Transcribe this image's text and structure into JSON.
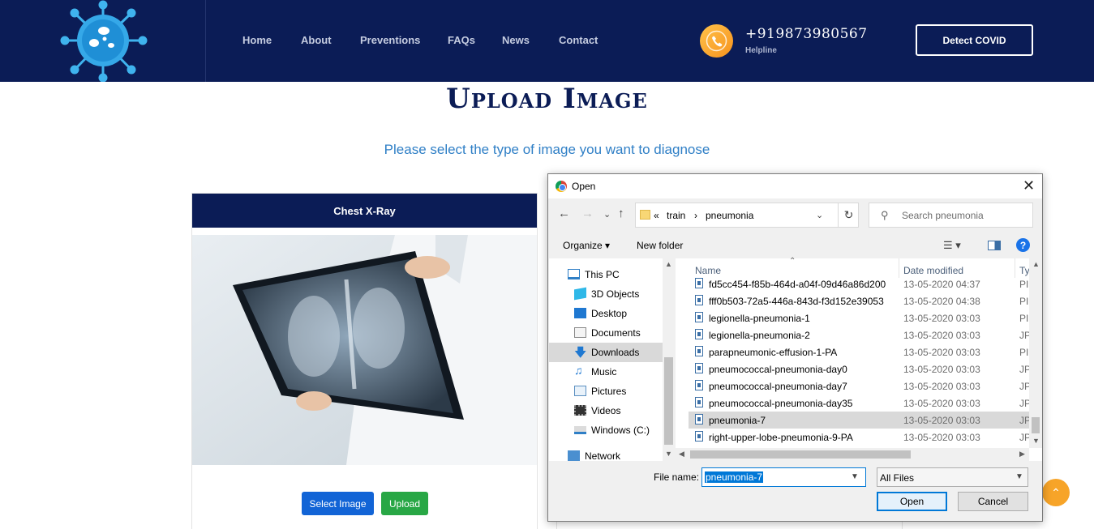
{
  "header": {
    "nav": [
      "Home",
      "About",
      "Preventions",
      "FAQs",
      "News",
      "Contact"
    ],
    "phone": "+919873980567",
    "helpline": "Helpline",
    "cta": "Detect COVID"
  },
  "main": {
    "title": "Upload Image",
    "subtitle": "Please select the type of image you want to diagnose",
    "card": {
      "title": "Chest X-Ray",
      "select_button": "Select Image",
      "upload_button": "Upload"
    }
  },
  "dialog": {
    "title": "Open",
    "breadcrumb": [
      "«",
      "train",
      "›",
      "pneumonia"
    ],
    "search_placeholder": "Search pneumonia",
    "organize": "Organize ▾",
    "new_folder": "New folder",
    "tree": [
      {
        "label": "This PC",
        "icon": "pc-icon"
      },
      {
        "label": "3D Objects",
        "icon": "cube-icon"
      },
      {
        "label": "Desktop",
        "icon": "desktop-icon"
      },
      {
        "label": "Documents",
        "icon": "documents-icon"
      },
      {
        "label": "Downloads",
        "icon": "download-icon"
      },
      {
        "label": "Music",
        "icon": "music-icon"
      },
      {
        "label": "Pictures",
        "icon": "pictures-icon"
      },
      {
        "label": "Videos",
        "icon": "videos-icon"
      },
      {
        "label": "Windows (C:)",
        "icon": "drive-icon"
      },
      {
        "label": "Network",
        "icon": "network-icon"
      }
    ],
    "columns": [
      "Name",
      "Date modified",
      "Ty"
    ],
    "files": [
      {
        "name": "fd5cc454-f85b-464d-a04f-09d46a86d200",
        "date": "13-05-2020 04:37",
        "type": "PI"
      },
      {
        "name": "fff0b503-72a5-446a-843d-f3d152e39053",
        "date": "13-05-2020 04:38",
        "type": "PI"
      },
      {
        "name": "legionella-pneumonia-1",
        "date": "13-05-2020 03:03",
        "type": "PI"
      },
      {
        "name": "legionella-pneumonia-2",
        "date": "13-05-2020 03:03",
        "type": "JP"
      },
      {
        "name": "parapneumonic-effusion-1-PA",
        "date": "13-05-2020 03:03",
        "type": "PI"
      },
      {
        "name": "pneumococcal-pneumonia-day0",
        "date": "13-05-2020 03:03",
        "type": "JP"
      },
      {
        "name": "pneumococcal-pneumonia-day7",
        "date": "13-05-2020 03:03",
        "type": "JP"
      },
      {
        "name": "pneumococcal-pneumonia-day35",
        "date": "13-05-2020 03:03",
        "type": "JP"
      },
      {
        "name": "pneumonia-7",
        "date": "13-05-2020 03:03",
        "type": "JP"
      },
      {
        "name": "right-upper-lobe-pneumonia-9-PA",
        "date": "13-05-2020 03:03",
        "type": "JP"
      }
    ],
    "selected_index": 8,
    "file_name_label": "File name:",
    "file_name_value": "pneumonia-7",
    "file_type": "All Files",
    "open_button": "Open",
    "cancel_button": "Cancel"
  }
}
